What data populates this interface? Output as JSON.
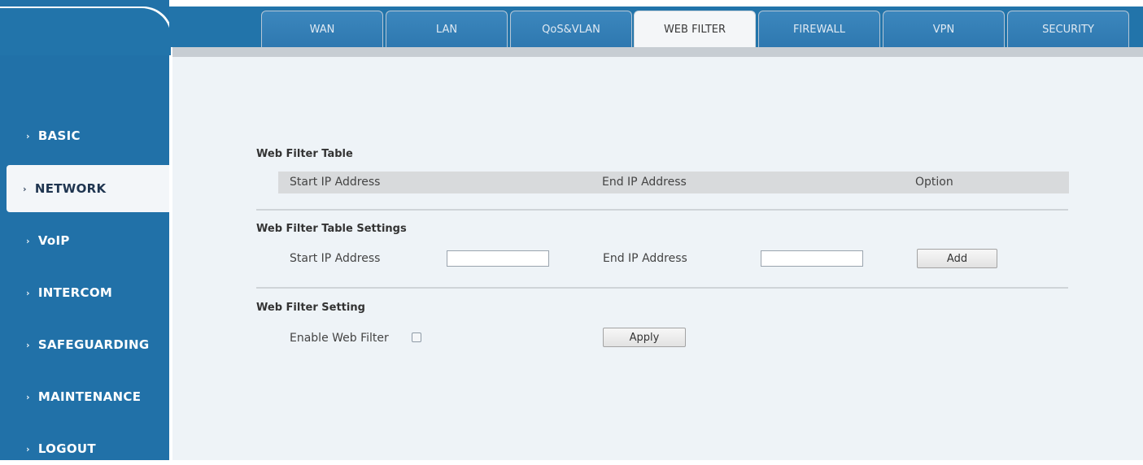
{
  "sidebar": {
    "items": [
      {
        "label": "BASIC",
        "active": false
      },
      {
        "label": "NETWORK",
        "active": true
      },
      {
        "label": "VoIP",
        "active": false
      },
      {
        "label": "INTERCOM",
        "active": false
      },
      {
        "label": "SAFEGUARDING",
        "active": false
      },
      {
        "label": "MAINTENANCE",
        "active": false
      },
      {
        "label": "LOGOUT",
        "active": false
      }
    ],
    "chevron": "›"
  },
  "tabs": [
    {
      "label": "WAN"
    },
    {
      "label": "LAN"
    },
    {
      "label": "QoS&VLAN"
    },
    {
      "label": "WEB FILTER",
      "active": true
    },
    {
      "label": "FIREWALL"
    },
    {
      "label": "VPN"
    },
    {
      "label": "SECURITY"
    }
  ],
  "web_filter_table": {
    "title": "Web Filter Table",
    "columns": [
      "Start IP Address",
      "End IP Address",
      "Option"
    ],
    "rows": []
  },
  "table_settings": {
    "title": "Web Filter Table Settings",
    "start_label": "Start IP Address",
    "start_value": "",
    "end_label": "End IP Address",
    "end_value": "",
    "add_button": "Add"
  },
  "filter_setting": {
    "title": "Web Filter Setting",
    "enable_label": "Enable Web Filter",
    "enabled": false,
    "apply_button": "Apply"
  },
  "colors": {
    "sidebar": "#2171a8",
    "content_bg": "#eef3f7",
    "active_tab": "#f4f6f8"
  }
}
